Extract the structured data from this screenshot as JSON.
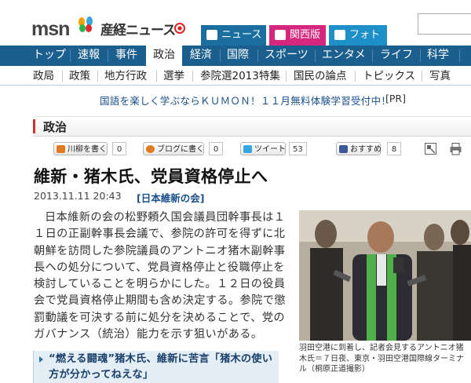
{
  "header": {
    "logo_msn": "msn",
    "logo_sankei": "産経ニュース",
    "tabs": [
      {
        "label": "ニュース",
        "color": "#1a6fa0"
      },
      {
        "label": "関西版",
        "color": "#d4277d"
      },
      {
        "label": "フォト",
        "color": "#1d8fc9"
      }
    ]
  },
  "nav_primary": [
    "トップ",
    "速報",
    "事件",
    "政治",
    "経済",
    "国際",
    "スポーツ",
    "エンタメ",
    "ライフ",
    "科学"
  ],
  "nav_primary_active": "政治",
  "nav_secondary": [
    "政局",
    "政策",
    "地方行政",
    "選挙",
    "参院選2013特集",
    "国民の論点",
    "トピックス",
    "写真"
  ],
  "promo": {
    "text": "国語を楽しく学ぶならＫＵＭＯＮ！１１月無料体験学習受付中！",
    "pr": "[PR]"
  },
  "section_title": "政治",
  "share": {
    "senryu": {
      "label": "川柳を書く",
      "count": "0"
    },
    "blog": {
      "label": "ブログに書く",
      "count": "0"
    },
    "tweet": {
      "label": "ツイート",
      "count": "53"
    },
    "like": {
      "label": "おすすめ",
      "count": "8"
    }
  },
  "article": {
    "title": "維新・猪木氏、党員資格停止へ",
    "datetime": "2013.11.11 20:43",
    "tag": "[日本維新の会]",
    "body": "日本維新の会の松野頼久国会議員団幹事長は１１日の正副幹事長会議で、参院の許可を得ずに北朝鮮を訪問した参院議員のアントニオ猪木副幹事長への処分について、党員資格停止と役職停止を検討していることを明らかにした。１２日の役員会で党員資格停止期間も含め決定する。参院で懲罰動議を可決する前に処分を決めることで、党のガバナンス（統治）能力を示す狙いがある。",
    "photo_caption": "羽田空港に到着し、記者会見するアントニオ猪木氏＝７日夜、東京・羽田空港国際線ターミナル（桐原正道撮影）",
    "related": "“燃える闘魂”猪木氏、維新に苦言「猪木の使い方が分かってねえな」"
  }
}
